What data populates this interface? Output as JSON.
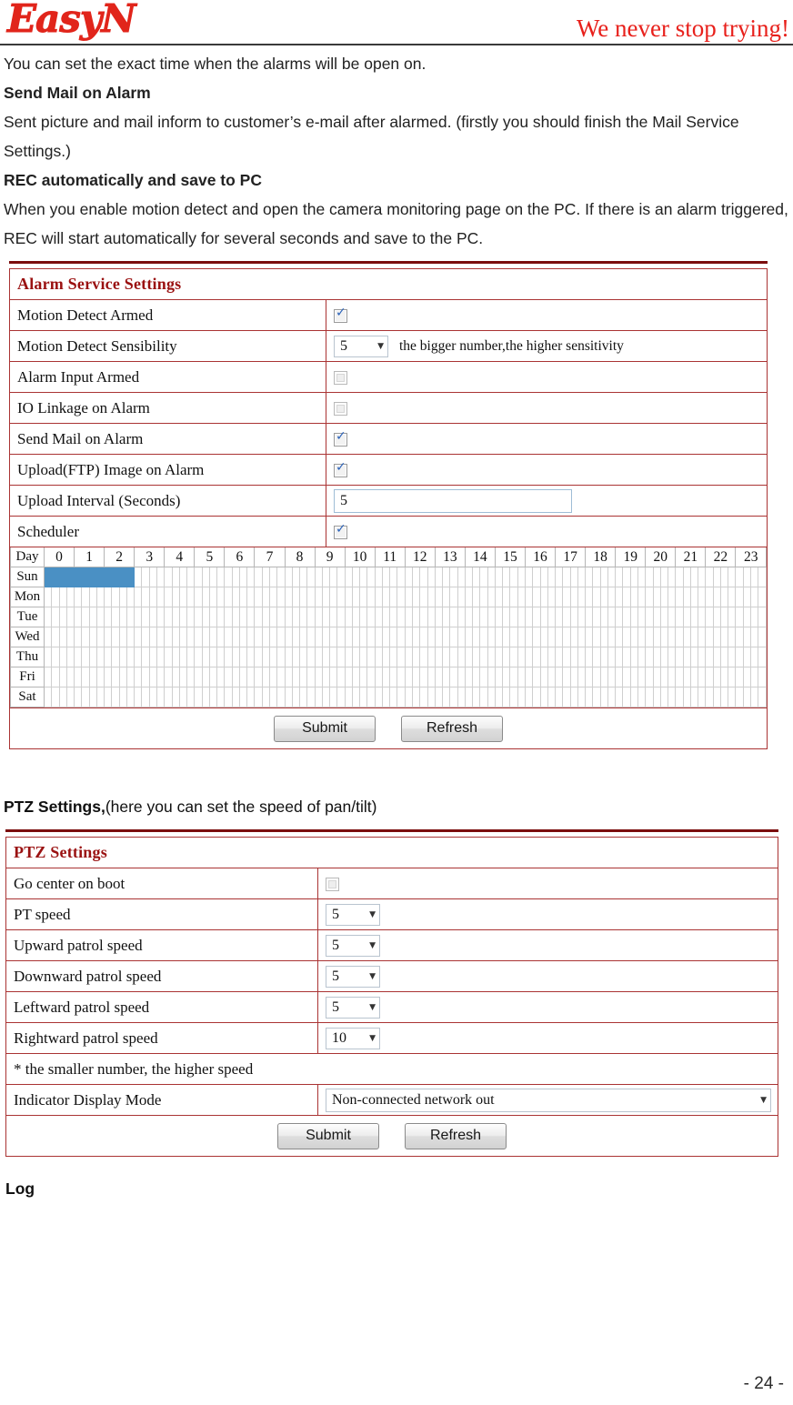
{
  "header": {
    "logo_text": "EasyN",
    "tagline": "We never stop trying!"
  },
  "intro": {
    "line1": "You can set the exact time when the alarms will be open on.",
    "heading1": "Send Mail on Alarm",
    "line2": "Sent picture and mail inform to customer’s e-mail after alarmed. (firstly you should finish the Mail Service Settings.)",
    "heading2": "REC automatically and save to PC",
    "line3": "When you enable motion detect and open the camera monitoring page on the PC. If there is an alarm triggered, REC will start automatically for several seconds and save to the PC."
  },
  "alarm_panel": {
    "title": "Alarm Service Settings",
    "rows": [
      {
        "label": "Motion Detect Armed",
        "control": "checkbox",
        "checked": true
      },
      {
        "label": "Motion Detect Sensibility",
        "control": "select",
        "value": "5",
        "note": "the bigger number,the higher sensitivity"
      },
      {
        "label": "Alarm Input Armed",
        "control": "checkbox",
        "checked": false
      },
      {
        "label": "IO Linkage on Alarm",
        "control": "checkbox",
        "checked": false
      },
      {
        "label": "Send Mail on Alarm",
        "control": "checkbox",
        "checked": true
      },
      {
        "label": "Upload(FTP) Image on Alarm",
        "control": "checkbox",
        "checked": true
      },
      {
        "label": " Upload Interval (Seconds)",
        "control": "text",
        "value": "5"
      },
      {
        "label": "Scheduler",
        "control": "checkbox",
        "checked": true
      }
    ],
    "scheduler": {
      "day_header": "Day",
      "hours": [
        "0",
        "1",
        "2",
        "3",
        "4",
        "5",
        "6",
        "7",
        "8",
        "9",
        "10",
        "11",
        "12",
        "13",
        "14",
        "15",
        "16",
        "17",
        "18",
        "19",
        "20",
        "21",
        "22",
        "23"
      ],
      "days": [
        "Sun",
        "Mon",
        "Tue",
        "Wed",
        "Thu",
        "Fri",
        "Sat"
      ],
      "slots_per_hour": 4,
      "selected": {
        "Sun": [
          0,
          1,
          2,
          3,
          4,
          5,
          6,
          7,
          8,
          9,
          10,
          11
        ],
        "Mon": [],
        "Tue": [],
        "Wed": [],
        "Thu": [],
        "Fri": [],
        "Sat": []
      },
      "selected_color": "#4a90c4"
    },
    "submit_label": "Submit",
    "refresh_label": "Refresh"
  },
  "ptz_intro": {
    "bold": "PTZ Settings,",
    "rest": "(here you can set the speed of pan/tilt)"
  },
  "ptz_panel": {
    "title": "PTZ Settings",
    "rows": [
      {
        "label": "Go center on boot",
        "control": "checkbox",
        "checked": false
      },
      {
        "label": "PT speed",
        "control": "select",
        "value": "5"
      },
      {
        "label": "Upward patrol speed",
        "control": "select",
        "value": "5"
      },
      {
        "label": "Downward patrol speed",
        "control": "select",
        "value": "5"
      },
      {
        "label": "Leftward patrol speed",
        "control": "select",
        "value": "5"
      },
      {
        "label": "Rightward patrol speed",
        "control": "select",
        "value": "10"
      }
    ],
    "note": "* the smaller number, the higher speed",
    "indicator_label": "Indicator Display Mode",
    "indicator_value": "Non-connected network out",
    "submit_label": "Submit",
    "refresh_label": "Refresh"
  },
  "log_heading": "Log",
  "footer": {
    "page_number": "- 24 -"
  },
  "colors": {
    "brand_red": "#e1251b",
    "panel_border": "#aa3333",
    "panel_title": "#9a1111",
    "rule": "#7b0d0d",
    "schedule_selected": "#4a90c4"
  }
}
